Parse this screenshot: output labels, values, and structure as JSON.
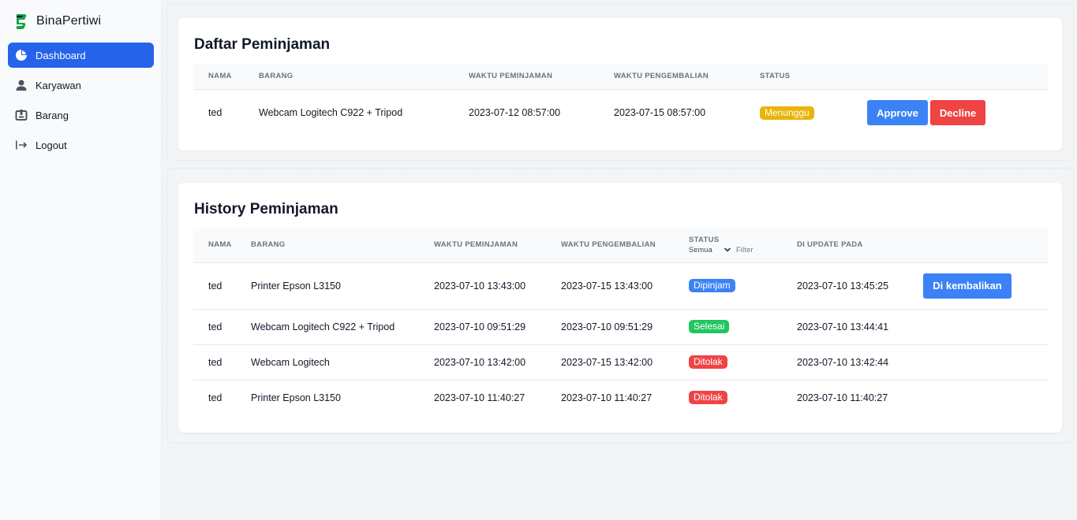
{
  "brand": {
    "name": "BinaPertiwi"
  },
  "sidebar": {
    "items": [
      {
        "label": "Dashboard",
        "icon": "pie-chart-icon",
        "active": true
      },
      {
        "label": "Karyawan",
        "icon": "user-icon",
        "active": false
      },
      {
        "label": "Barang",
        "icon": "box-icon",
        "active": false
      },
      {
        "label": "Logout",
        "icon": "logout-icon",
        "active": false
      }
    ]
  },
  "daftar": {
    "title": "Daftar Peminjaman",
    "headers": [
      "NAMA",
      "BARANG",
      "WAKTU PEMINJAMAN",
      "WAKTU PENGEMBALIAN",
      "STATUS"
    ],
    "rows": [
      {
        "nama": "ted",
        "barang": "Webcam Logitech C922 + Tripod",
        "pinjam": "2023-07-12 08:57:00",
        "kembali": "2023-07-15 08:57:00",
        "status": "Menunggu"
      }
    ],
    "approve_label": "Approve",
    "decline_label": "Decline"
  },
  "history": {
    "title": "History Peminjaman",
    "headers": [
      "NAMA",
      "BARANG",
      "WAKTU PEMINJAMAN",
      "WAKTU PENGEMBALIAN",
      "STATUS",
      "DI UPDATE PADA"
    ],
    "filter": {
      "selected": "Semua",
      "label": "Filter"
    },
    "rows": [
      {
        "nama": "ted",
        "barang": "Printer Epson L3150",
        "pinjam": "2023-07-10 13:43:00",
        "kembali": "2023-07-15 13:43:00",
        "status": "Dipinjam",
        "update": "2023-07-10 13:45:25"
      },
      {
        "nama": "ted",
        "barang": "Webcam Logitech C922 + Tripod",
        "pinjam": "2023-07-10 09:51:29",
        "kembali": "2023-07-10 09:51:29",
        "status": "Selesai",
        "update": "2023-07-10 13:44:41"
      },
      {
        "nama": "ted",
        "barang": "Webcam Logitech",
        "pinjam": "2023-07-10 13:42:00",
        "kembali": "2023-07-15 13:42:00",
        "status": "Ditolak",
        "update": "2023-07-10 13:42:44"
      },
      {
        "nama": "ted",
        "barang": "Printer Epson L3150",
        "pinjam": "2023-07-10 11:40:27",
        "kembali": "2023-07-10 11:40:27",
        "status": "Ditolak",
        "update": "2023-07-10 11:40:27"
      }
    ],
    "return_label": "Di kembalikan"
  },
  "colors": {
    "primary": "#2563eb",
    "approve": "#3b82f6",
    "decline": "#ef4444",
    "status_menunggu": "#eab308",
    "status_dipinjam": "#3b82f6",
    "status_selesai": "#22c55e",
    "status_ditolak": "#ef4444",
    "brand_green": "#16a34a"
  }
}
